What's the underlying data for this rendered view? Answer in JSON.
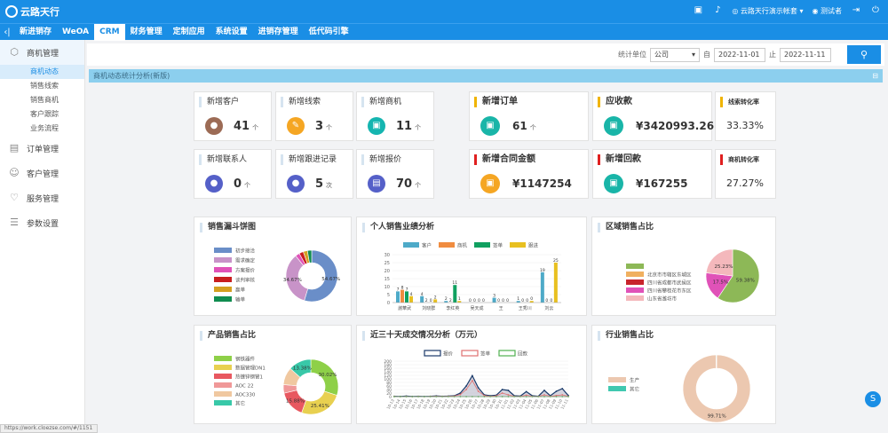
{
  "topbar": {
    "logo": "云路天行",
    "company": "云路天行演示帐套",
    "user": "测试者"
  },
  "nav": {
    "items": [
      "新进销存",
      "WeOA",
      "CRM",
      "财务管理",
      "定制应用",
      "系统设置",
      "进销存管理",
      "低代码引擎"
    ],
    "active": 2
  },
  "sidebar": {
    "top": "商机管理",
    "subs": [
      "商机动态",
      "销售线索",
      "销售商机",
      "客户跟踪",
      "业务流程"
    ],
    "sections": [
      "订单管理",
      "客户管理",
      "服务管理",
      "参数设置"
    ]
  },
  "filter": {
    "unit_label": "统计单位",
    "unit_value": "公司",
    "from_label": "自",
    "from": "2022-11-01",
    "to_label": "止",
    "to": "2022-11-11",
    "search_icon": "search-icon"
  },
  "title": "商机动态统计分析(新版)",
  "kpi": [
    {
      "label": "新增客户",
      "value": "41",
      "unit": "个",
      "color": "#9c6b55",
      "icon": "user-icon"
    },
    {
      "label": "新增线索",
      "value": "3",
      "unit": "个",
      "color": "#f5a623",
      "icon": "clue-icon"
    },
    {
      "label": "新增商机",
      "value": "11",
      "unit": "个",
      "color": "#15b5b0",
      "icon": "opportunity-icon"
    },
    {
      "label": "新增联系人",
      "value": "0",
      "unit": "个",
      "color": "#5560c8",
      "icon": "contact-icon"
    },
    {
      "label": "新增跟进记录",
      "value": "5",
      "unit": "次",
      "color": "#5560c8",
      "icon": "followup-icon"
    },
    {
      "label": "新增报价",
      "value": "70",
      "unit": "个",
      "color": "#5560c8",
      "icon": "quote-icon"
    }
  ],
  "big": [
    {
      "label": "新增订单",
      "value": "61",
      "unit": "个",
      "color": "#19b5a8",
      "accent": "#f0b400",
      "icon": "order-icon"
    },
    {
      "label": "应收款",
      "value": "¥3420993.26",
      "unit": "",
      "color": "#19b5a8",
      "accent": "#f0b400",
      "icon": "receivable-icon"
    },
    {
      "label": "新增合同金额",
      "value": "¥1147254",
      "unit": "",
      "color": "#f5a623",
      "accent": "#e02020",
      "icon": "contract-icon"
    },
    {
      "label": "新增回款",
      "value": "¥167255",
      "unit": "",
      "color": "#19b5a8",
      "accent": "#e02020",
      "icon": "payment-icon"
    }
  ],
  "rates": [
    {
      "label": "线索转化率",
      "value": "33.33%",
      "accent": "#f0b400"
    },
    {
      "label": "商机转化率",
      "value": "27.27%",
      "accent": "#e02020"
    }
  ],
  "panels": {
    "funnel": "销售漏斗饼图",
    "personal": "个人销售业绩分析",
    "region": "区域销售占比",
    "product": "产品销售占比",
    "trend": "近三十天成交情况分析（万元）",
    "industry": "行业销售占比"
  },
  "chart_data": [
    {
      "id": "funnel",
      "type": "pie",
      "legend": [
        "初步接洽",
        "需求确定",
        "方案报价",
        "谈判审核",
        "赢单",
        "输单"
      ],
      "colors": [
        "#6a8ec8",
        "#c893c8",
        "#e052b8",
        "#c81e1e",
        "#d4a020",
        "#108c50"
      ],
      "values": [
        54.67,
        34.67,
        2.67,
        2.67,
        2.67,
        2.66
      ],
      "labels": [
        "54.67%",
        "34.67%",
        "",
        "",
        "",
        ""
      ]
    },
    {
      "id": "personal",
      "type": "bar",
      "legend": [
        "客户",
        "商机",
        "签单",
        "跟进"
      ],
      "colors": [
        "#4eaac8",
        "#f08c40",
        "#10a060",
        "#e8c020"
      ],
      "categories": [
        "謝華武",
        "刘晓群",
        "李红英",
        "吴天成",
        "王",
        "王秀川",
        "刘云"
      ],
      "ylim": [
        0,
        30
      ],
      "yticks": [
        0,
        5,
        10,
        15,
        20,
        25,
        30
      ],
      "series": [
        [
          7,
          4,
          1,
          0,
          3,
          1,
          19
        ],
        [
          8,
          0,
          0,
          0,
          0,
          0,
          0
        ],
        [
          7,
          0,
          11,
          0,
          0,
          0,
          0
        ],
        [
          4,
          2,
          1,
          0,
          0,
          1,
          25
        ]
      ],
      "labels": [
        [
          "7",
          "4",
          "2",
          "0",
          "3",
          "1",
          "19"
        ],
        [
          "8",
          "2",
          "2",
          "0",
          "0",
          "0",
          "0"
        ],
        [
          "7",
          "0",
          "11",
          "0",
          "0",
          "0",
          "0"
        ],
        [
          "4",
          "2",
          "1",
          "0",
          "0",
          "0",
          "25"
        ]
      ]
    },
    {
      "id": "region",
      "type": "pie",
      "legend": [
        "",
        "北京市市辖区东城区",
        "四川省成都市武侯区",
        "四川省攀枝花市东区",
        "山东省潍坊市"
      ],
      "colors": [
        "#8db857",
        "#f0b060",
        "#c8242c",
        "#e052b8",
        "#f4b8bc"
      ],
      "values": [
        59.38,
        0,
        0,
        17.5,
        23.12
      ],
      "labels": [
        "59.38%",
        "",
        "",
        "17.5%",
        "25.23%"
      ]
    },
    {
      "id": "product",
      "type": "pie",
      "legend": [
        "钢铁器件",
        "数据管理DN1",
        "热镀锌钢管1",
        "AOC 22",
        "AOC330",
        "其它"
      ],
      "colors": [
        "#8ed048",
        "#e8d050",
        "#e85860",
        "#f09898",
        "#f0c8a0",
        "#38c8a8"
      ],
      "values": [
        30.02,
        25.41,
        15.88,
        5.0,
        10.31,
        13.38
      ],
      "labels": [
        "30.02%",
        "25.41%",
        "15.88%",
        "",
        "",
        "13.38%"
      ]
    },
    {
      "id": "trend",
      "type": "line",
      "legend": [
        "报价",
        "签单",
        "回款"
      ],
      "colors": [
        "#1a3a6a",
        "#e07070",
        "#50b050"
      ],
      "categories": [
        "10-13",
        "10-14",
        "10-15",
        "10-16",
        "10-17",
        "10-18",
        "10-19",
        "10-20",
        "10-21",
        "10-22",
        "10-23",
        "10-24",
        "10-25",
        "10-26",
        "10-27",
        "10-28",
        "10-29",
        "10-30",
        "10-31",
        "11-01",
        "11-02",
        "11-03",
        "11-04",
        "11-05",
        "11-06",
        "11-07",
        "11-08",
        "11-09",
        "11-10",
        "11-11"
      ],
      "ylim": [
        0,
        200
      ],
      "yticks": [
        0,
        20,
        40,
        60,
        80,
        100,
        120,
        140,
        160,
        180,
        200
      ],
      "series": [
        [
          2,
          1,
          3,
          1,
          2,
          1,
          2,
          4,
          2,
          3,
          5,
          20,
          60,
          118,
          50,
          10,
          5,
          8,
          40,
          35,
          5,
          3,
          28,
          5,
          2,
          35,
          5,
          30,
          45,
          6
        ],
        [
          1,
          0,
          1,
          0,
          1,
          0,
          1,
          2,
          1,
          2,
          3,
          12,
          40,
          90,
          30,
          6,
          2,
          4,
          20,
          10,
          2,
          1,
          8,
          2,
          1,
          10,
          2,
          6,
          10,
          2
        ],
        [
          0,
          0,
          0,
          0,
          0,
          0,
          0,
          0,
          0,
          0,
          0,
          0,
          0,
          0,
          0,
          0,
          0,
          0,
          0,
          0,
          0,
          0,
          0,
          0,
          0,
          0,
          0,
          0,
          0,
          0
        ]
      ]
    },
    {
      "id": "industry",
      "type": "pie",
      "legend": [
        "生产",
        "其它"
      ],
      "colors": [
        "#ecc8b0",
        "#40c8b0"
      ],
      "values": [
        99.71,
        0.29
      ],
      "labels": [
        "99.71%",
        ""
      ]
    }
  ],
  "status": "https://work.cloezse.com/#/1151"
}
